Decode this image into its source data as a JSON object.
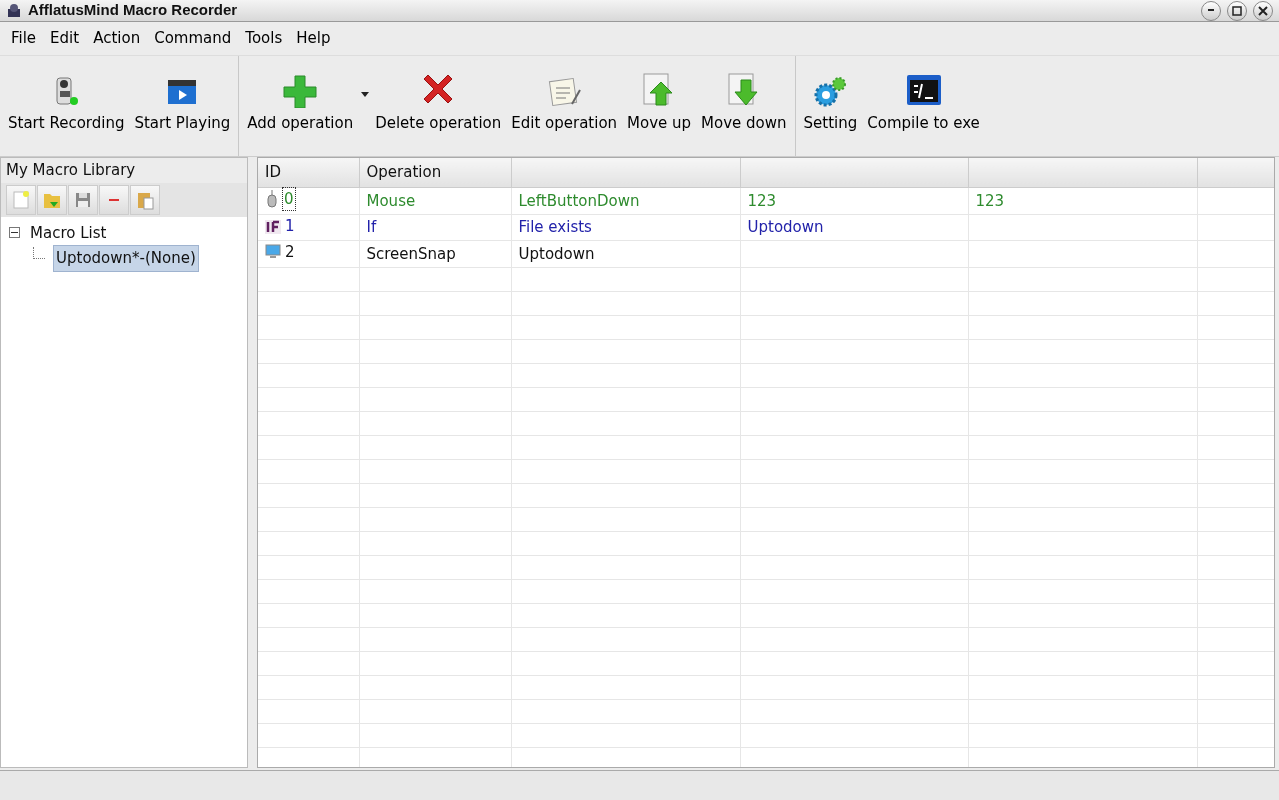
{
  "window": {
    "title": "AfflatusMind Macro Recorder"
  },
  "menu": [
    "File",
    "Edit",
    "Action",
    "Command",
    "Tools",
    "Help"
  ],
  "toolbar": {
    "groups": [
      [
        {
          "label": "Start Recording",
          "kind": "camera"
        },
        {
          "label": "Start Playing",
          "kind": "clapper"
        }
      ],
      [
        {
          "label": "Add operation",
          "kind": "add",
          "dropdown": true
        },
        {
          "label": "Delete operation",
          "kind": "delete"
        },
        {
          "label": "Edit operation",
          "kind": "edit"
        },
        {
          "label": "Move up",
          "kind": "up"
        },
        {
          "label": "Move down",
          "kind": "down"
        }
      ],
      [
        {
          "label": "Setting",
          "kind": "gear"
        },
        {
          "label": "Compile to exe",
          "kind": "console"
        }
      ]
    ]
  },
  "library": {
    "title": "My Macro Library",
    "tree": [
      {
        "label": "Macro List",
        "expanded": true,
        "selected": false,
        "children": [
          {
            "label": "Uptodown*-(None)",
            "selected": true
          }
        ]
      }
    ]
  },
  "table": {
    "columns": [
      "ID",
      "Operation"
    ],
    "rows": [
      {
        "kind": "mouse",
        "color": "#2e8b2e",
        "focused": true,
        "cells": [
          "0",
          "Mouse",
          "LeftButtonDown",
          "123",
          "123"
        ]
      },
      {
        "kind": "if",
        "color": "#2222aa",
        "focused": false,
        "cells": [
          "1",
          "If",
          "File exists",
          "Uptodown"
        ]
      },
      {
        "kind": "screen",
        "color": "#111111",
        "focused": false,
        "cells": [
          "2",
          "ScreenSnap",
          "Uptodown"
        ]
      }
    ]
  }
}
